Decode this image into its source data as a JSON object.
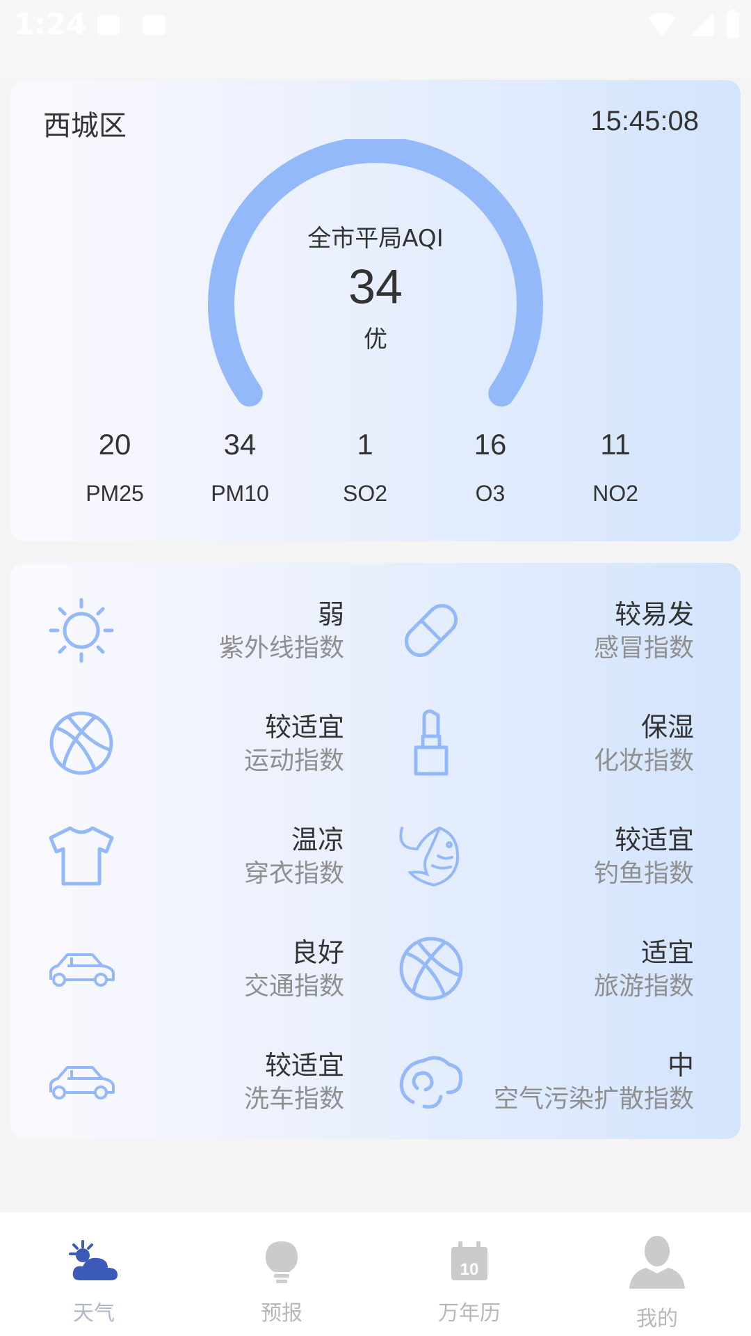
{
  "status_bar": {
    "time": "1:24"
  },
  "aqi_card": {
    "district": "西城区",
    "time": "15:45:08",
    "aqi_label": "全市平局AQI",
    "aqi_value": "34",
    "aqi_level": "优",
    "gauge_color": "#93b9fb",
    "pollutants": [
      {
        "value": "20",
        "name": "PM25"
      },
      {
        "value": "34",
        "name": "PM10"
      },
      {
        "value": "1",
        "name": "SO2"
      },
      {
        "value": "16",
        "name": "O3"
      },
      {
        "value": "11",
        "name": "NO2"
      }
    ]
  },
  "life_indices": {
    "icon_color": "#93b9fb",
    "items": [
      {
        "icon": "sun-icon",
        "value": "弱",
        "label": "紫外线指数"
      },
      {
        "icon": "pill-icon",
        "value": "较易发",
        "label": "感冒指数"
      },
      {
        "icon": "basketball-icon",
        "value": "较适宜",
        "label": "运动指数"
      },
      {
        "icon": "lipstick-icon",
        "value": "保湿",
        "label": "化妆指数"
      },
      {
        "icon": "tshirt-icon",
        "value": "温凉",
        "label": "穿衣指数"
      },
      {
        "icon": "fish-icon",
        "value": "较适宜",
        "label": "钓鱼指数"
      },
      {
        "icon": "car-icon",
        "value": "良好",
        "label": "交通指数"
      },
      {
        "icon": "basketball-icon",
        "value": "适宜",
        "label": "旅游指数"
      },
      {
        "icon": "car-icon",
        "value": "较适宜",
        "label": "洗车指数"
      },
      {
        "icon": "wind-icon",
        "value": "中",
        "label": "空气污染扩散指数"
      }
    ]
  },
  "bottom_nav": {
    "items": [
      {
        "icon": "weather-icon",
        "label": "天气",
        "active": true
      },
      {
        "icon": "lightbulb-icon",
        "label": "预报",
        "active": false
      },
      {
        "icon": "calendar-icon",
        "label": "万年历",
        "active": false,
        "badge": "10"
      },
      {
        "icon": "user-icon",
        "label": "我的",
        "active": false
      }
    ]
  }
}
